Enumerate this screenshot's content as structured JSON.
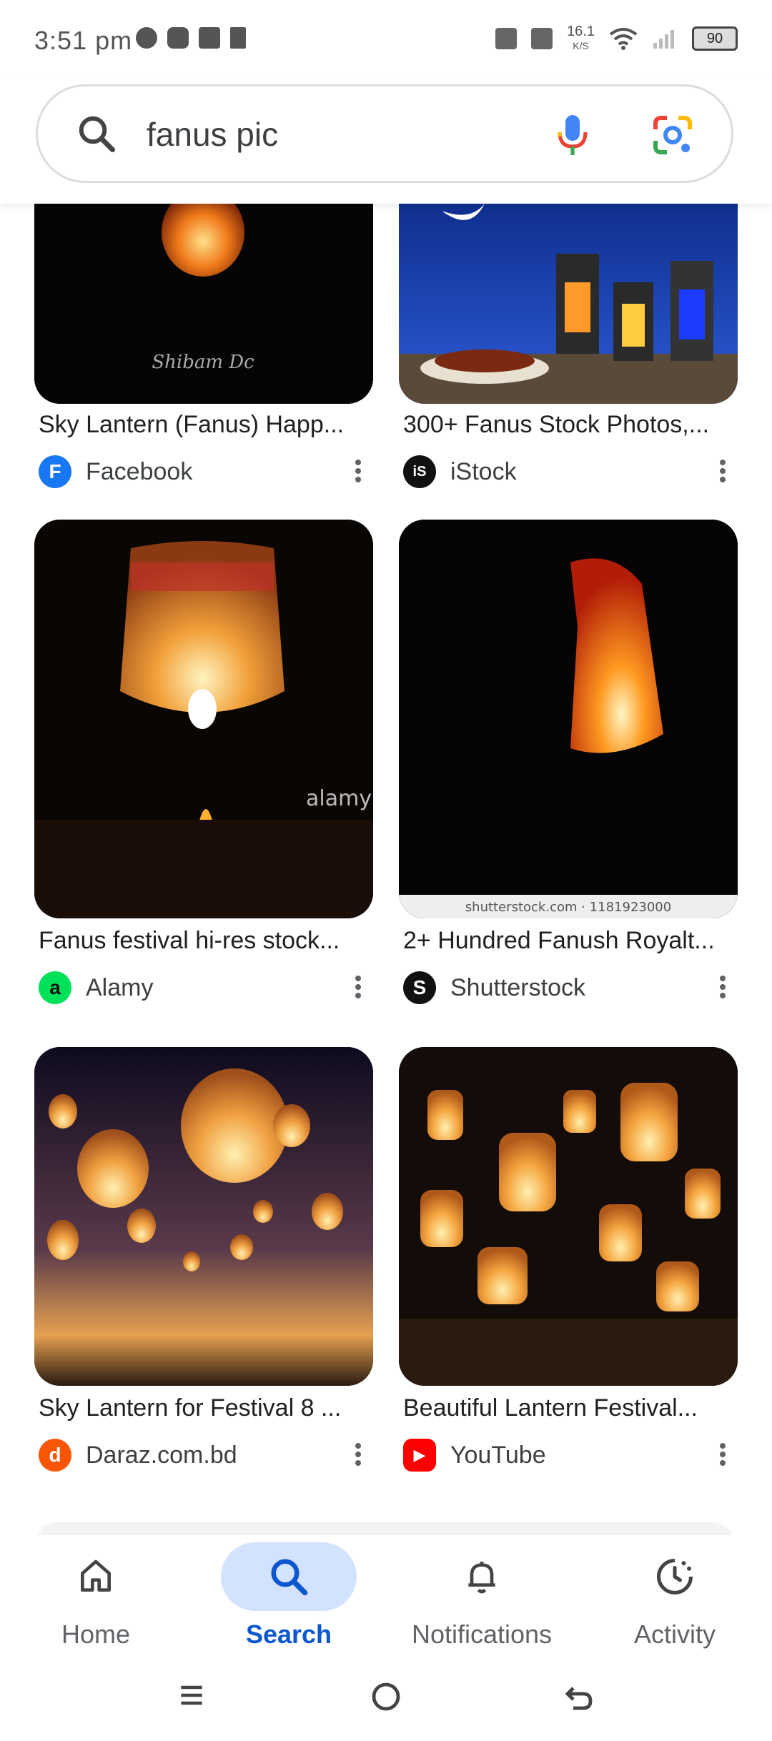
{
  "status_bar": {
    "time": "3:51 pm",
    "network_rate_value": "16.1",
    "network_rate_unit": "K/S",
    "battery": "90",
    "app_icons": [
      "facebook-icon",
      "snapchat-icon",
      "pinwheel-icon",
      "tiktok-icon"
    ],
    "system_icons": [
      "vibrate-icon",
      "nfc-icon",
      "wifi-icon",
      "signal-icon"
    ]
  },
  "search": {
    "query": "fanus pic"
  },
  "results": [
    {
      "title": "Sky Lantern (Fanus) Happ...",
      "source": "Facebook",
      "favicon": "F",
      "favicon_color": "#1877f2"
    },
    {
      "title": "300+ Fanus Stock Photos,...",
      "source": "iStock",
      "favicon": "iS",
      "favicon_color": "#111111"
    },
    {
      "title": "Fanus festival hi-res stock...",
      "source": "Alamy",
      "favicon": "a",
      "favicon_color": "#00e15a"
    },
    {
      "title": "2+ Hundred Fanush Royalt...",
      "source": "Shutterstock",
      "favicon": "S",
      "favicon_color": "#111111"
    },
    {
      "title": "Sky Lantern for Festival 8 ...",
      "source": "Daraz.com.bd",
      "favicon": "d",
      "favicon_color": "#f85606"
    },
    {
      "title": "Beautiful Lantern Festival...",
      "source": "YouTube",
      "favicon": "▶",
      "favicon_color": "#ff0000"
    }
  ],
  "image_text": {
    "shutterstock_caption": "shutterstock.com · 1181923000",
    "alamy_watermark": "alamy"
  },
  "bottom_nav": {
    "items": [
      {
        "label": "Home",
        "icon": "home-icon"
      },
      {
        "label": "Search",
        "icon": "search-icon"
      },
      {
        "label": "Notifications",
        "icon": "bell-icon"
      },
      {
        "label": "Activity",
        "icon": "activity-icon"
      }
    ],
    "active": "Search"
  },
  "colors": {
    "accent": "#0b57d0",
    "active_pill": "#d3e3fd"
  }
}
